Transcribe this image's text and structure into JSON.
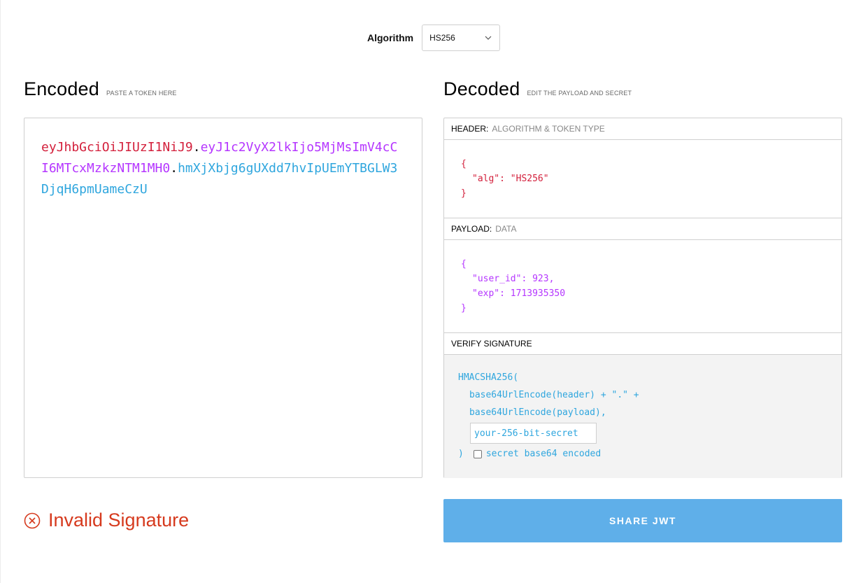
{
  "algorithm": {
    "label": "Algorithm",
    "selected": "HS256"
  },
  "encoded": {
    "title": "Encoded",
    "subtitle": "PASTE A TOKEN HERE",
    "token_header": "eyJhbGciOiJIUzI1NiJ9",
    "token_payload": "eyJ1c2VyX2lkIjo5MjMsImV4cCI6MTcxMzkzNTM1MH0",
    "token_signature": "hmXjXbjg6gUXdd7hvIpUEmYTBGLW3DjqH6pmUameCzU",
    "dot": "."
  },
  "decoded": {
    "title": "Decoded",
    "subtitle": "EDIT THE PAYLOAD AND SECRET",
    "header_section": {
      "title": "HEADER:",
      "subtitle": "ALGORITHM & TOKEN TYPE",
      "open": "{",
      "line1": "\"alg\": \"HS256\"",
      "close": "}"
    },
    "payload_section": {
      "title": "PAYLOAD:",
      "subtitle": "DATA",
      "open": "{",
      "line1": "\"user_id\": 923,",
      "line2": "\"exp\": 1713935350",
      "close": "}"
    },
    "signature_section": {
      "title": "VERIFY SIGNATURE",
      "line1": "HMACSHA256(",
      "line2": "base64UrlEncode(header) + \".\" +",
      "line3": "base64UrlEncode(payload),",
      "secret_placeholder": "your-256-bit-secret",
      "close": ")",
      "checkbox_label": "secret base64 encoded",
      "checkbox_checked": false
    }
  },
  "status": {
    "text": "Invalid Signature",
    "color": "#d63a1e"
  },
  "share_button": {
    "label": "SHARE JWT",
    "color": "#5fafe9"
  }
}
